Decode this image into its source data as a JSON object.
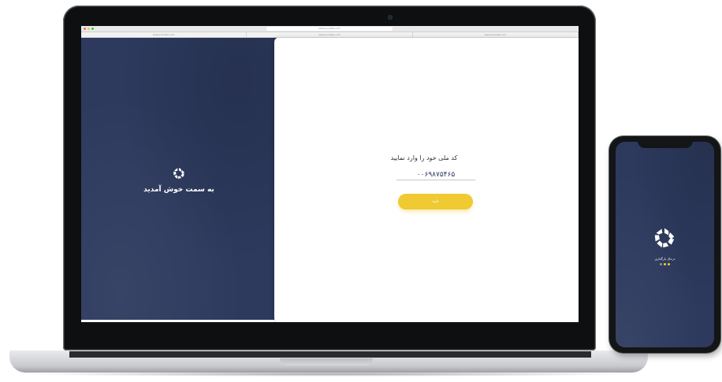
{
  "browser": {
    "url": "www.yoursite.com",
    "tabs": [
      "www.yoursite.com",
      "www.yoursite.com",
      "www.yoursite.com"
    ]
  },
  "login": {
    "welcome": "به سمت خوش آمدید",
    "prompt": "کد ملی خود را وارد نمایید",
    "code_value": "۰۰۶۹۸۷۵۴۶۵",
    "confirm_label": "تایید"
  },
  "phone": {
    "caption": "درحال بارگذاری"
  },
  "colors": {
    "navy": "#2d3a5e",
    "accent": "#f0ca32",
    "dot_inactive": "#8b92aa"
  },
  "icons": {
    "app_logo": "app-logo-icon"
  }
}
